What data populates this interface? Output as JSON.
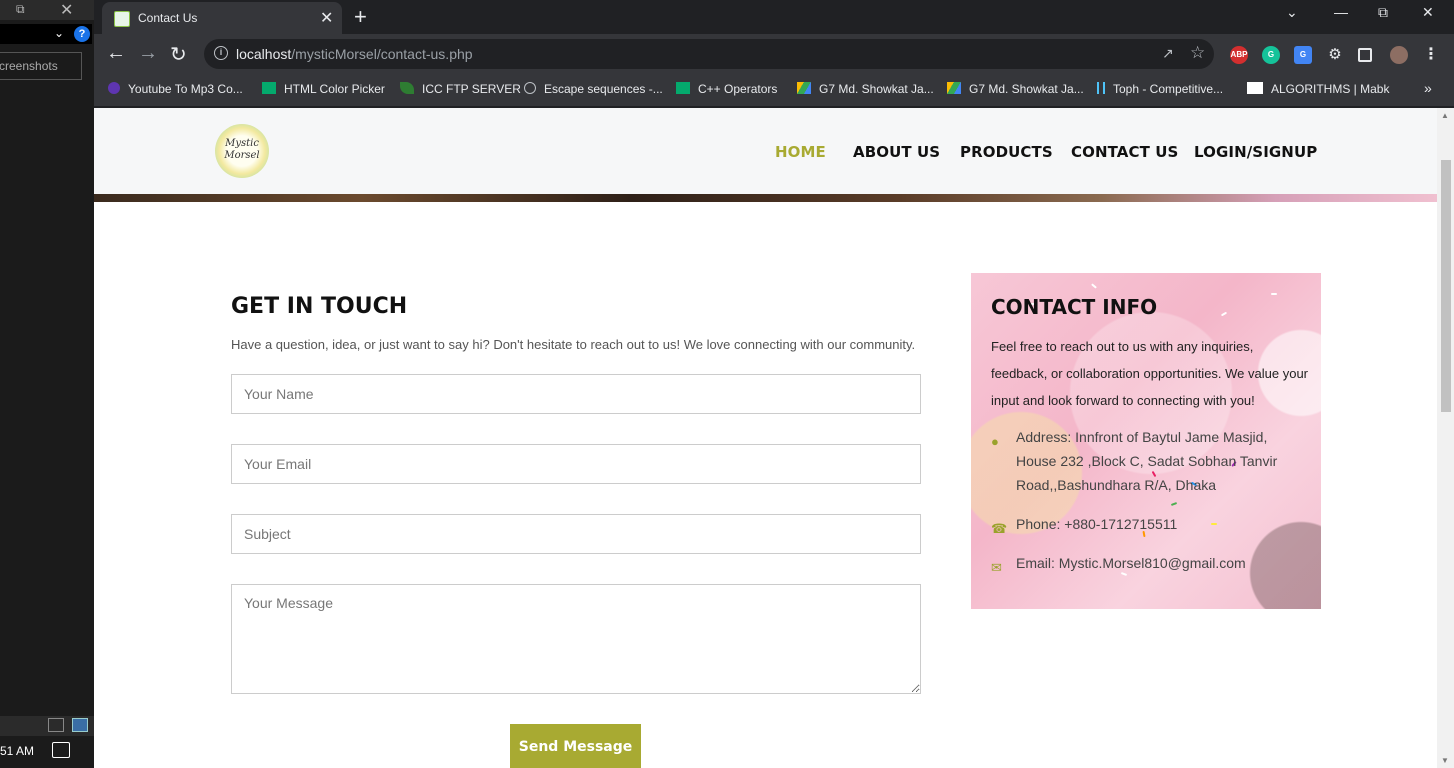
{
  "side_panel": {
    "restore_icon": "restore-icon",
    "close_icon": "close-icon",
    "help_label": "?",
    "search_text": "creenshots",
    "clock": "51 AM"
  },
  "browser": {
    "tab_title": "Contact Us",
    "url_host": "localhost",
    "url_path": "/mysticMorsel/contact-us.php",
    "extensions": [
      "ABP",
      "G",
      "G",
      "",
      "",
      ""
    ],
    "bookmarks": [
      {
        "label": "Youtube To Mp3 Co...",
        "color": "#7c4dff"
      },
      {
        "label": "HTML Color Picker",
        "color": "#04aa6d"
      },
      {
        "label": "ICC FTP SERVER",
        "color": "#2e7d32"
      },
      {
        "label": "Escape sequences -...",
        "color": "#9e9e9e"
      },
      {
        "label": "C++ Operators",
        "color": "#04aa6d"
      },
      {
        "label": "G7 Md. Showkat Ja...",
        "color": "#fbbc04"
      },
      {
        "label": "G7 Md. Showkat Ja...",
        "color": "#fbbc04"
      },
      {
        "label": "Toph - Competitive...",
        "color": "#4fc3f7"
      },
      {
        "label": "ALGORITHMS | Mabk",
        "color": "#ffffff"
      }
    ],
    "more_bookmarks": "»"
  },
  "site": {
    "logo_text": "Mystic Morsel",
    "nav": [
      "HOME",
      "ABOUT US",
      "PRODUCTS",
      "CONTACT US",
      "LOGIN/SIGNUP"
    ],
    "accent": "#a8aa32"
  },
  "contact_form": {
    "title": "GET IN TOUCH",
    "lead": "Have a question, idea, or just want to say hi? Don't hesitate to reach out to us! We love connecting with our community.",
    "name_placeholder": "Your Name",
    "email_placeholder": "Your Email",
    "subject_placeholder": "Subject",
    "message_placeholder": "Your Message",
    "submit_label": "Send Message"
  },
  "contact_info": {
    "title": "CONTACT INFO",
    "text": "Feel free to reach out to us with any inquiries, feedback, or collaboration opportunities. We value your input and look forward to connecting with you!",
    "address": "Address: Innfront of Baytul Jame Masjid, House 232 ,Block C, Sadat Sobhan Tanvir Road,,Bashundhara R/A, Dhaka",
    "phone": "Phone: +880-1712715511",
    "email": "Email: Mystic.Morsel810@gmail.com"
  }
}
